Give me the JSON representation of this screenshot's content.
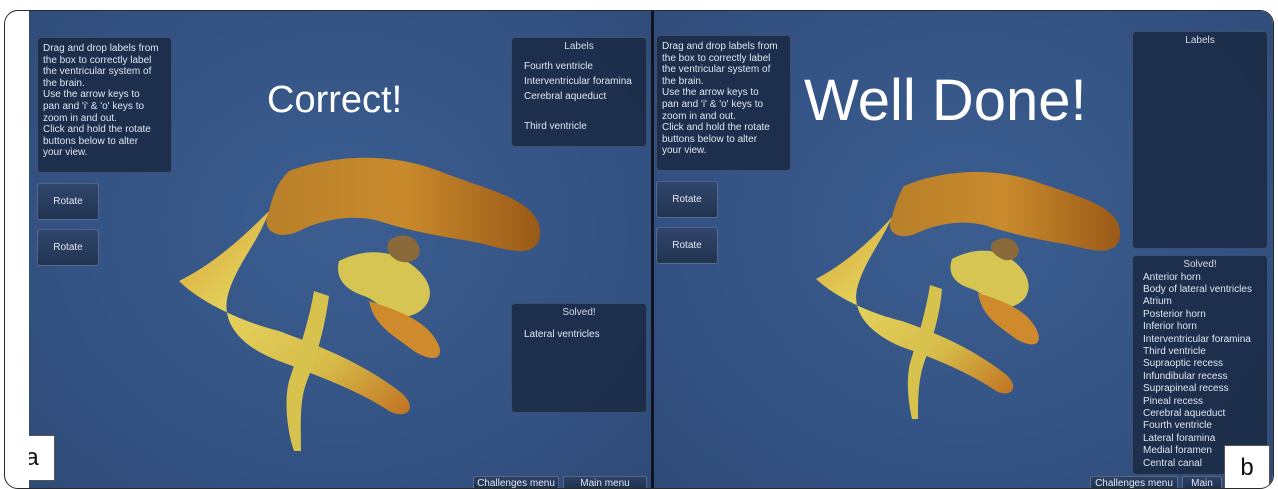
{
  "panel_a": {
    "instructions": [
      "Drag and drop labels from",
      "the box to correctly label",
      "the ventricular system of",
      "the brain.",
      "Use the arrow keys to",
      "pan and 'i' & 'o' keys to",
      "zoom in and out.",
      "Click and hold the rotate",
      "buttons below to alter",
      "your view."
    ],
    "rotate_1": "Rotate",
    "rotate_2": "Rotate",
    "feedback": "Correct!",
    "labels_title": "Labels",
    "labels": [
      "Fourth ventricle",
      "Interventricular foramina",
      "Cerebral aqueduct",
      "",
      "Third ventricle"
    ],
    "solved_title": "Solved!",
    "solved": [
      "Lateral ventricles"
    ],
    "challenges_menu": "Challenges menu",
    "main_menu": "Main menu",
    "tag": "a"
  },
  "panel_b": {
    "instructions": [
      "Drag and drop labels from",
      "the box to correctly label",
      "the ventricular system of",
      "the brain.",
      "Use the arrow keys to",
      "pan and 'i' & 'o' keys to",
      "zoom in and out.",
      "Click and hold the rotate",
      "buttons below to alter",
      "your view."
    ],
    "rotate_1": "Rotate",
    "rotate_2": "Rotate",
    "feedback": "Well Done!",
    "labels_title": "Labels",
    "solved_title": "Solved!",
    "solved": [
      "Anterior horn",
      "Body of lateral ventricles",
      "Atrium",
      "Posterior horn",
      "Inferior horn",
      "Interventricular foramina",
      "Third ventricle",
      "Supraoptic recess",
      "Infundibular recess",
      "Suprapineal recess",
      "Pineal recess",
      "Cerebral aqueduct",
      "Fourth ventricle",
      "Lateral foramina",
      "Medial foramen",
      "Central canal"
    ],
    "challenges_menu": "Challenges menu",
    "main_menu": "Main",
    "tag": "b"
  },
  "colors": {
    "background": "#355486",
    "box": "#1a2a44",
    "brain_light": "#e0cc5a",
    "brain_dark": "#b8701e"
  }
}
